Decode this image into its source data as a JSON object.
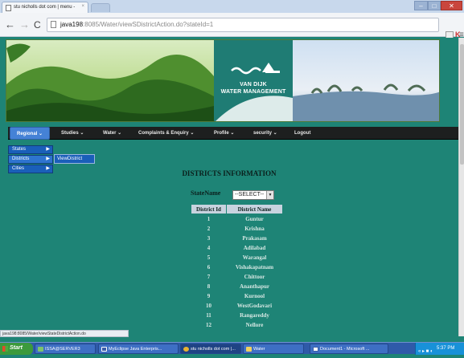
{
  "browser": {
    "tab_title": "stu nicholls dot com | menu - ",
    "tab_close": "×",
    "url_host": "java198",
    "url_rest": ":8085/Water/viewSDistrictAction.do?stateId=1",
    "status_url": "java198:8085/Water/viewStateDistrictAction.do",
    "window_controls": {
      "minimize": "–",
      "maximize": "□",
      "close": "✕"
    },
    "nav": {
      "back": "←",
      "forward": "→",
      "reload": "C"
    }
  },
  "banner": {
    "logo_line1": "VAN DIJK",
    "logo_line2": "WATER MANAGEMENT"
  },
  "navbar": {
    "items": [
      {
        "label": "Regional ⌄",
        "active": true
      },
      {
        "label": "Studies ⌄"
      },
      {
        "label": "Water ⌄"
      },
      {
        "label": "Complaints & Enquiry ⌄"
      },
      {
        "label": "Profile ⌄"
      },
      {
        "label": "security ⌄"
      },
      {
        "label": "Logout"
      }
    ]
  },
  "submenu": {
    "items": [
      {
        "label": "States",
        "arrow": "▶"
      },
      {
        "label": "Districts",
        "arrow": "▶"
      },
      {
        "label": "Cities",
        "arrow": "▶"
      }
    ],
    "flyout": "ViewDistrict"
  },
  "content": {
    "title": "DISTRICTS INFORMATION",
    "state_label": "StateName",
    "select_value": "--SELECT--",
    "table_headers": [
      "District Id",
      "District Name"
    ],
    "rows": [
      [
        "1",
        "Guntur"
      ],
      [
        "2",
        "Krishna"
      ],
      [
        "3",
        "Prakasam"
      ],
      [
        "4",
        "Adilabad"
      ],
      [
        "5",
        "Warangal"
      ],
      [
        "6",
        "Vishakapatnam"
      ],
      [
        "7",
        "Chittoor"
      ],
      [
        "8",
        "Ananthapur"
      ],
      [
        "9",
        "Kurnool"
      ],
      [
        "10",
        "WestGodavari"
      ],
      [
        "11",
        "Rangareddy"
      ],
      [
        "12",
        "Nellore"
      ]
    ]
  },
  "taskbar": {
    "start": "Start",
    "tasks": [
      "ISSA@SERVER3",
      "MyEclipse Java Enterpris...",
      "stu nicholls dot com |...",
      "Water",
      "Document1 - Microsoft ..."
    ],
    "tray_icons": "« ▸ ■ ◐",
    "clock": "5:37 PM"
  },
  "colors": {
    "page_bg": "#1e8476",
    "navbar_bg": "#1d1f1f",
    "active_nav": "#4582d6",
    "submenu_bg": "#1a5fb9",
    "table_header_bg": "#c8d3df",
    "logo_panel": "#1f7c74"
  }
}
